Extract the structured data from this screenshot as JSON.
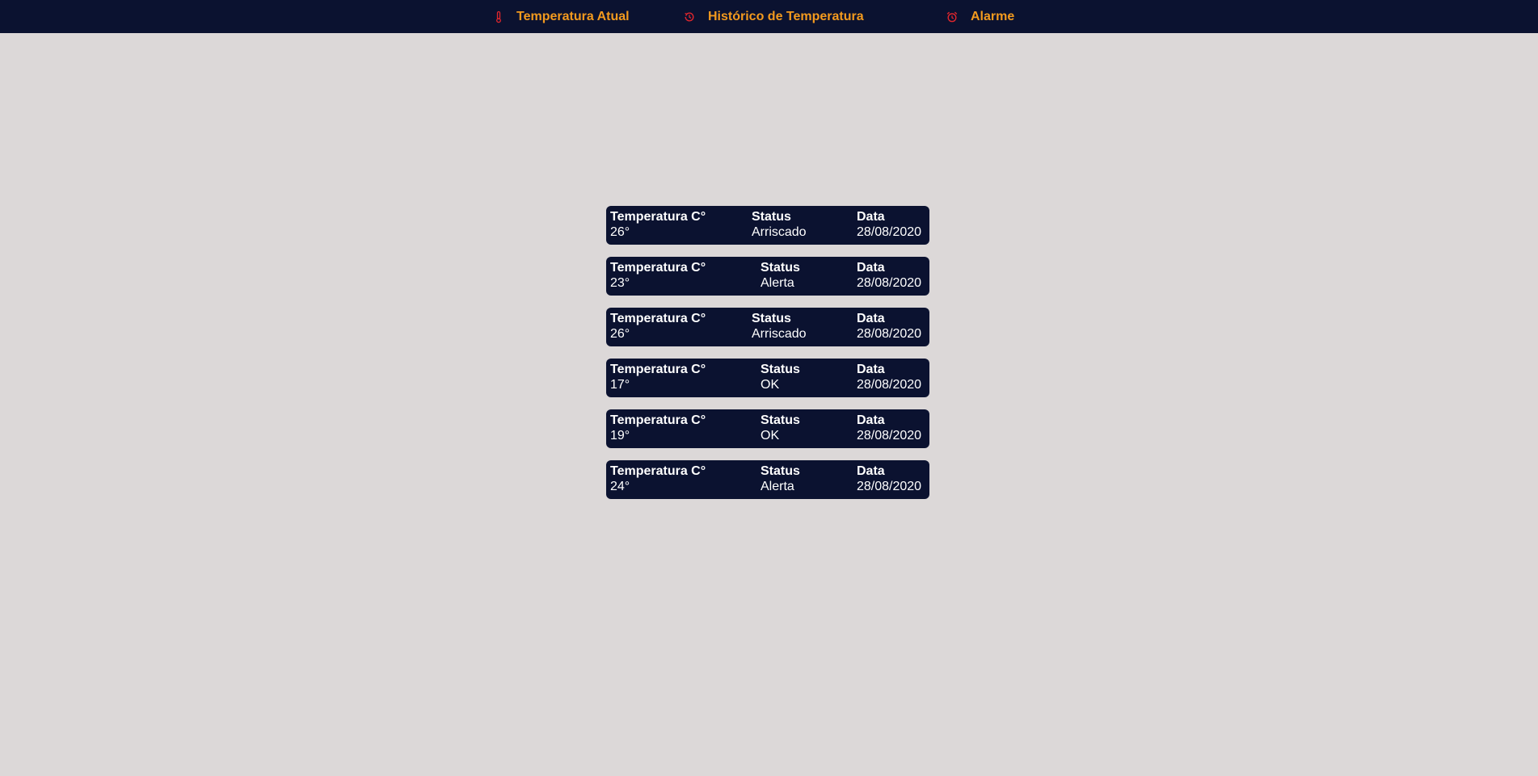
{
  "nav": {
    "items": [
      {
        "label": "Temperatura Atual",
        "icon": "thermometer-icon"
      },
      {
        "label": "Histórico de Temperatura",
        "icon": "history-icon"
      },
      {
        "label": "Alarme",
        "icon": "alarm-clock-icon"
      }
    ]
  },
  "colors": {
    "navbar_bg": "#0b1230",
    "nav_text": "#f39a1e",
    "nav_icon": "#e0262d",
    "page_bg": "#dcd8d8",
    "card_bg": "#0b1230",
    "card_text": "#ffffff"
  },
  "records": [
    {
      "temp_header": "Temperatura C°",
      "temp": "26°",
      "status_header": "Status",
      "status": "Arriscado",
      "date_header": "Data",
      "date": "28/08/2020"
    },
    {
      "temp_header": "Temperatura C°",
      "temp": "23°",
      "status_header": "Status",
      "status": "Alerta",
      "date_header": "Data",
      "date": "28/08/2020"
    },
    {
      "temp_header": "Temperatura C°",
      "temp": "26°",
      "status_header": "Status",
      "status": "Arriscado",
      "date_header": "Data",
      "date": "28/08/2020"
    },
    {
      "temp_header": "Temperatura C°",
      "temp": "17°",
      "status_header": "Status",
      "status": "OK",
      "date_header": "Data",
      "date": "28/08/2020"
    },
    {
      "temp_header": "Temperatura C°",
      "temp": "19°",
      "status_header": "Status",
      "status": "OK",
      "date_header": "Data",
      "date": "28/08/2020"
    },
    {
      "temp_header": "Temperatura C°",
      "temp": "24°",
      "status_header": "Status",
      "status": "Alerta",
      "date_header": "Data",
      "date": "28/08/2020"
    }
  ]
}
